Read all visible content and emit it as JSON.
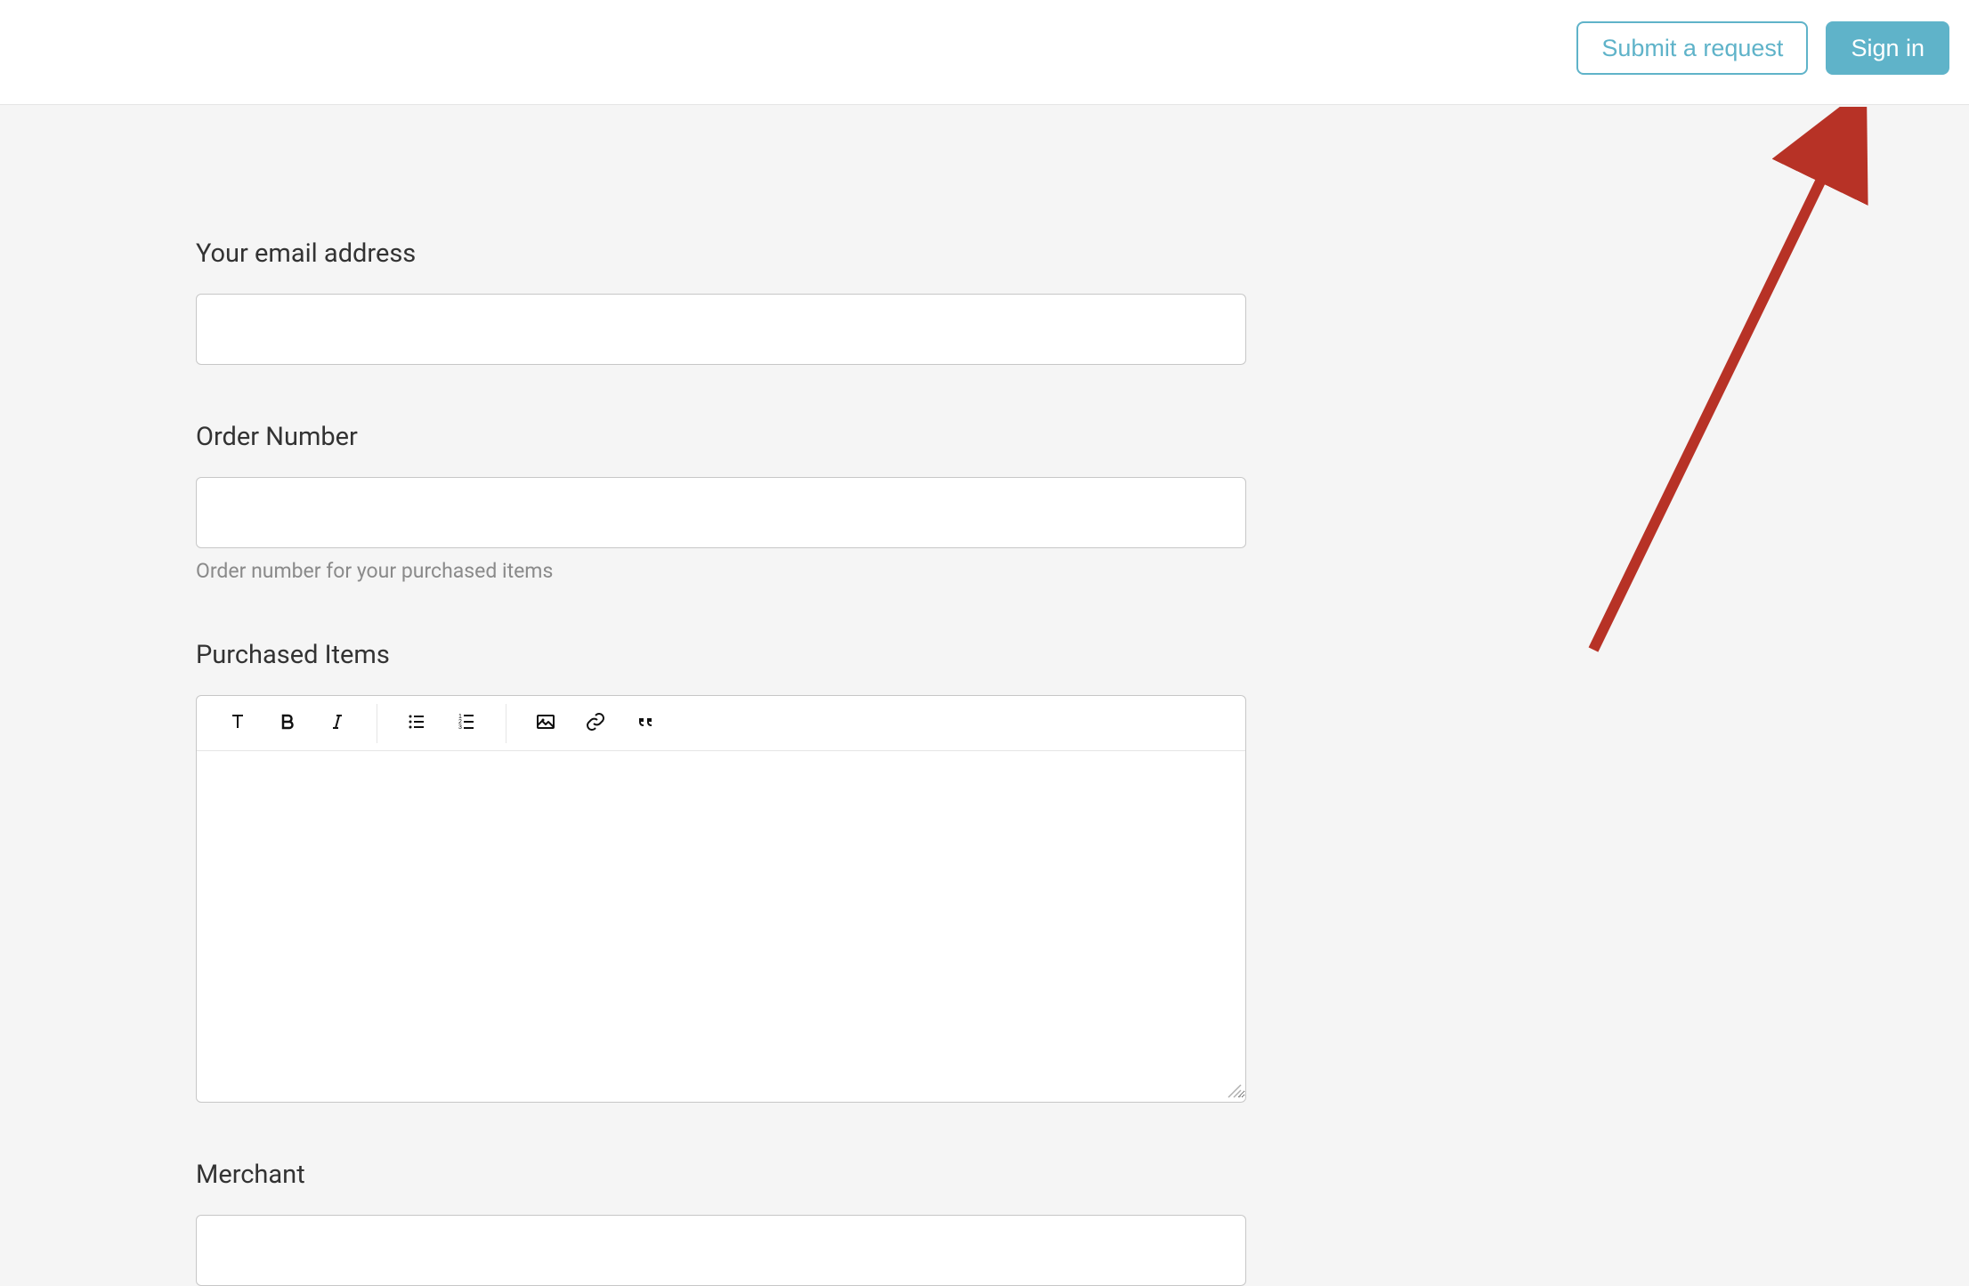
{
  "header": {
    "submit_request_label": "Submit a request",
    "sign_in_label": "Sign in"
  },
  "form": {
    "email": {
      "label": "Your email address",
      "value": ""
    },
    "order_number": {
      "label": "Order Number",
      "value": "",
      "hint": "Order number for your purchased items"
    },
    "purchased_items": {
      "label": "Purchased Items",
      "value": ""
    },
    "merchant": {
      "label": "Merchant",
      "value": ""
    }
  },
  "editor_toolbar": {
    "icons": {
      "paragraph": "paragraph-style-icon",
      "bold": "bold-icon",
      "italic": "italic-icon",
      "bullet_list": "bullet-list-icon",
      "numbered_list": "numbered-list-icon",
      "image": "image-icon",
      "link": "link-icon",
      "quote": "quote-icon"
    }
  },
  "colors": {
    "accent": "#5fb3c9",
    "text": "#333333",
    "hint": "#8a8a8a",
    "border": "#c7c7c7",
    "bg": "#f5f5f5",
    "annotation_arrow": "#b73226"
  }
}
